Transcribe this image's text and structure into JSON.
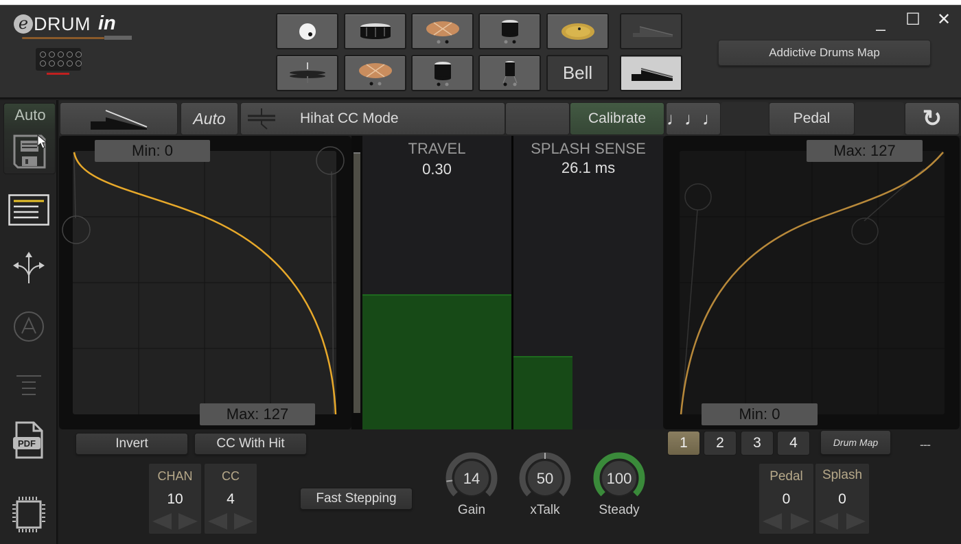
{
  "app": {
    "logo_prefix": "e",
    "logo_main": "DRUM",
    "logo_suffix": "in",
    "window_controls": {
      "minimize": "_",
      "maximize": "☐",
      "close": "✕"
    }
  },
  "header": {
    "instrument_tiles_row1": [
      {
        "name": "kick",
        "icon": "kick-drum-icon"
      },
      {
        "name": "snare",
        "icon": "snare-drum-icon"
      },
      {
        "name": "crash",
        "icon": "crash-cymbal-icon"
      },
      {
        "name": "tom",
        "icon": "tom-icon"
      },
      {
        "name": "ride",
        "icon": "ride-cymbal-icon"
      },
      {
        "name": "pedal-off",
        "icon": "hihat-pedal-icon"
      }
    ],
    "instrument_tiles_row2": [
      {
        "name": "hihat",
        "icon": "hihat-icon"
      },
      {
        "name": "crash-2",
        "icon": "crash-cymbal-icon"
      },
      {
        "name": "tom-2",
        "icon": "tom-icon"
      },
      {
        "name": "floor-tom",
        "icon": "floor-tom-icon"
      },
      {
        "name": "bell",
        "label": "Bell"
      },
      {
        "name": "pedal-on",
        "icon": "hihat-pedal-icon"
      }
    ],
    "map_button": "Addictive Drums Map"
  },
  "sidebar": {
    "auto_label": "Auto",
    "items": [
      {
        "name": "save",
        "icon": "floppy-disk-icon"
      },
      {
        "name": "list",
        "icon": "list-icon",
        "active": true
      },
      {
        "name": "routing",
        "icon": "split-arrows-icon"
      },
      {
        "name": "auto-mode",
        "icon": "circle-a-icon"
      },
      {
        "name": "levels",
        "icon": "levels-icon"
      },
      {
        "name": "pdf",
        "icon": "pdf-file-icon",
        "label": "PDF"
      },
      {
        "name": "chip",
        "icon": "chip-icon"
      }
    ]
  },
  "toolbar": {
    "pedal_icon": "hihat-pedal-icon",
    "auto_label": "Auto",
    "mode_icon": "hihat-icon",
    "mode_label": "Hihat CC Mode",
    "calibrate_label": "Calibrate",
    "notes_icon": "music-notes-icon",
    "notes_glyph": "♩♩♩",
    "pedal_label": "Pedal",
    "reset_icon": "refresh-icon",
    "reset_glyph": "↻"
  },
  "left_curve": {
    "min_label": "Min: 0",
    "max_label": "Max: 127"
  },
  "right_curve": {
    "max_label": "Max: 127",
    "min_label": "Min: 0"
  },
  "meters": {
    "travel": {
      "title": "TRAVEL",
      "value": "0.30",
      "fill_fraction": 0.46
    },
    "splash": {
      "title": "SPLASH SENSE",
      "value": "26.1 ms",
      "fill_fraction": 0.25
    }
  },
  "bottom": {
    "invert_label": "Invert",
    "cc_with_hit_label": "CC With Hit",
    "fast_stepping_label": "Fast Stepping",
    "chan": {
      "label": "CHAN",
      "value": "10"
    },
    "cc": {
      "label": "CC",
      "value": "4"
    },
    "knobs": [
      {
        "name": "gain",
        "label": "Gain",
        "value": "14",
        "fraction": 0.14,
        "color": "#4a4a4a"
      },
      {
        "name": "xtalk",
        "label": "xTalk",
        "value": "50",
        "fraction": 0.5,
        "color": "#4a4a4a"
      },
      {
        "name": "steady",
        "label": "Steady",
        "value": "100",
        "fraction": 1.0,
        "color": "#3a8a3a"
      }
    ],
    "pages": [
      "1",
      "2",
      "3",
      "4"
    ],
    "active_page": "1",
    "drum_map_label": "Drum Map",
    "status_dashes": "---",
    "pedal": {
      "label": "Pedal",
      "value": "0"
    },
    "splash": {
      "label": "Splash",
      "value": "0"
    }
  },
  "colors": {
    "curve": "#e8a92a",
    "meter_green": "#174a17",
    "active_page": "#7a6f52"
  }
}
